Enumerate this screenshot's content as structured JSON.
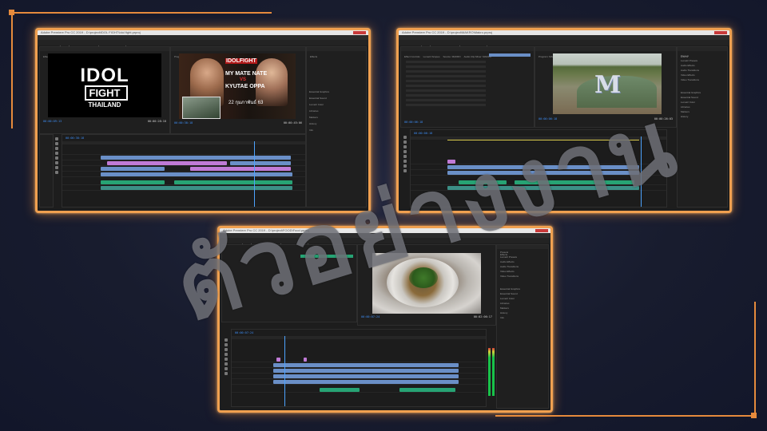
{
  "overlay_text": "ตัวอย่างงาน",
  "accent_color": "#e58a3c",
  "screens": [
    {
      "title_bar": "Adobe Premiere Pro CC 2019 - D:\\project\\IDOL FIGHT\\Idol fight.prproj",
      "menu": [
        "File",
        "Edit",
        "Clip",
        "Sequence",
        "Markers",
        "Graphics",
        "Window",
        "Help"
      ],
      "workspaces": [
        "Learning",
        "Assembly",
        "Editing",
        "Color",
        "Effects",
        "Audio",
        "Graphics",
        "Libraries"
      ],
      "source_tabs": [
        "Effect Controls",
        "Lumetri Scopes",
        "Source: IDOL FIGHT TRAILER.mp4",
        "Audio Clip Mixer: IDOLFIGHT"
      ],
      "program_tab": "Program: IDOLFIGHT",
      "source_timecode": "00:00:09:13",
      "source_duration": "00:00:28:18",
      "program_timecode": "00:00:38:18",
      "program_duration": "00:00:45:06",
      "timeline_timecode": "00:00:38:18",
      "logo_lines": [
        "IDOL",
        "FIGHT",
        "THAILAND"
      ],
      "poster": {
        "brand": "IDOLFIGHT",
        "line1": "MY MATE NATE",
        "vs": "VS",
        "line2": "KYUTAE OPPA",
        "date": "22 กุมภาพันธ์ 63"
      },
      "effects_panel": {
        "title": "Effects",
        "items": [
          "Essential Graphics",
          "Essential Sound",
          "Lumetri Color",
          "Libraries",
          "Markers",
          "History",
          "Info"
        ]
      }
    },
    {
      "title_bar": "Adobe Premiere Pro CC 2019 - D:\\project\\MAKRO\\Makro.prproj",
      "menu": [
        "File",
        "Edit",
        "Clip",
        "Sequence",
        "Markers",
        "Graphics",
        "Window",
        "Help"
      ],
      "workspaces": [
        "Learning",
        "Assembly",
        "Editing",
        "Color",
        "Effects",
        "Audio",
        "Graphics",
        "Libraries"
      ],
      "source_tabs": [
        "Effect Controls",
        "Lumetri Scopes",
        "Source: MAKRO",
        "Audio Clip Mixer: MAKRO"
      ],
      "program_tab": "Program: MAKRO",
      "source_timecode": "00:00:06:18",
      "program_timecode": "00:00:06:18",
      "program_duration": "00:00:26:03",
      "timeline_timecode": "00:00:06:18",
      "overlay_letter": "M",
      "effects_panel": {
        "title": "Effects",
        "items": [
          "Presets",
          "Lumetri Presets",
          "Audio Effects",
          "Audio Transitions",
          "Video Effects",
          "Video Transitions",
          "Essential Graphics",
          "Essential Sound",
          "Lumetri Color",
          "Libraries",
          "Markers",
          "History"
        ]
      }
    },
    {
      "title_bar": "Adobe Premiere Pro CC 2019 - D:\\project\\FOOD\\Food.prproj",
      "menu": [
        "File",
        "Edit",
        "Clip",
        "Sequence",
        "Markers",
        "Graphics",
        "Window",
        "Help"
      ],
      "workspaces": [
        "Learning",
        "Assembly",
        "Editing",
        "Color",
        "Effects",
        "Audio",
        "Graphics",
        "Libraries"
      ],
      "program_timecode": "00:00:07:24",
      "program_duration": "00:02:06:17",
      "timeline_timecode": "00:00:07:24",
      "effects_panel": {
        "title": "Effects",
        "items": [
          "Presets",
          "Lumetri Presets",
          "Audio Effects",
          "Audio Transitions",
          "Video Effects",
          "Video Transitions",
          "Essential Graphics",
          "Essential Sound",
          "Lumetri Color",
          "Libraries",
          "Markers",
          "History",
          "Info"
        ]
      }
    }
  ]
}
